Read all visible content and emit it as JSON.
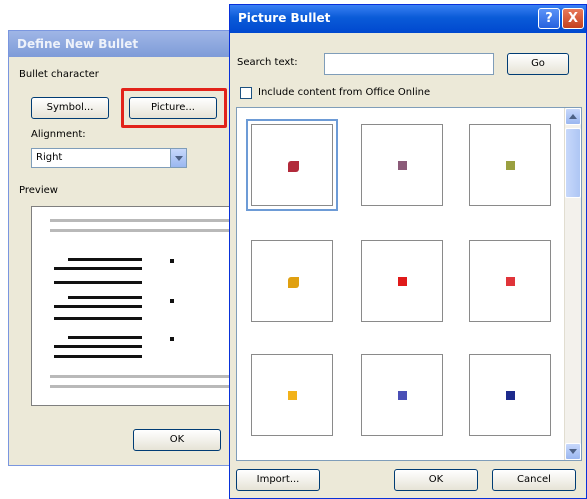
{
  "back_dialog": {
    "title": "Define New Bullet",
    "bullet_character_label": "Bullet character",
    "symbol_button": "Symbol...",
    "picture_button": "Picture...",
    "alignment_label": "Alignment:",
    "alignment_value": "Right",
    "preview_label": "Preview",
    "ok_button": "OK"
  },
  "front_dialog": {
    "title": "Picture Bullet",
    "help_button": "?",
    "close_button": "X",
    "search_label": "Search text:",
    "search_value": "",
    "go_button": "Go",
    "include_online_label": "Include content from Office Online",
    "include_online_checked": false,
    "bullets": [
      {
        "color": "#b22a3a",
        "icon": "decorative-bullet-icon",
        "selected": true
      },
      {
        "color": "#8b5a78",
        "icon": "square-bullet-icon",
        "selected": false
      },
      {
        "color": "#9aa040",
        "icon": "square-bullet-icon",
        "selected": false
      },
      {
        "color": "#e0a010",
        "icon": "decorative-bullet-icon",
        "selected": false
      },
      {
        "color": "#e01a1a",
        "icon": "square-bullet-icon",
        "selected": false
      },
      {
        "color": "#e0343a",
        "icon": "square-bullet-icon",
        "selected": false
      },
      {
        "color": "#f2b21a",
        "icon": "square-bullet-icon",
        "selected": false
      },
      {
        "color": "#4a4fb6",
        "icon": "square-bullet-icon",
        "selected": false
      },
      {
        "color": "#1d2a8c",
        "icon": "square-bullet-icon",
        "selected": false
      }
    ],
    "import_button": "Import...",
    "ok_button": "OK",
    "cancel_button": "Cancel"
  }
}
